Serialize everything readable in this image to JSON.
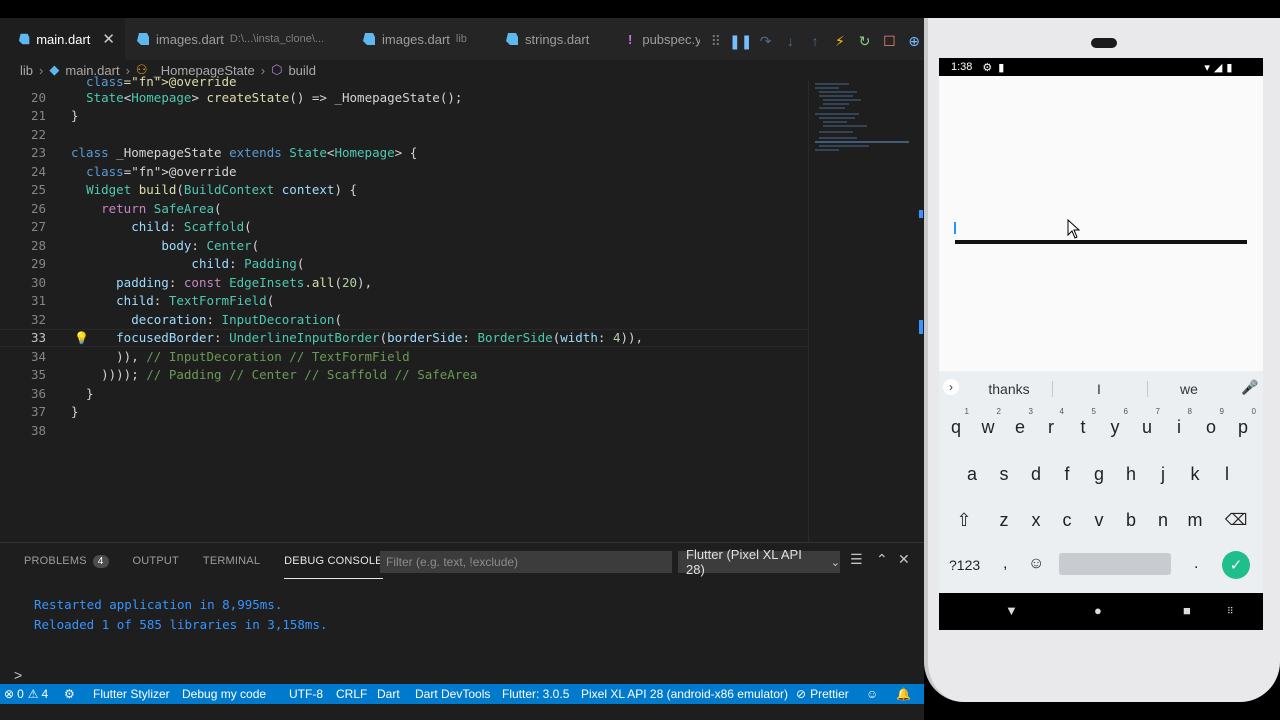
{
  "tabs": [
    {
      "label": "main.dart",
      "desc": "",
      "icon": "dart-icon",
      "active": true
    },
    {
      "label": "images.dart",
      "desc": "D:\\...\\insta_clone\\...",
      "icon": "dart-icon",
      "active": false
    },
    {
      "label": "images.dart",
      "desc": "lib",
      "icon": "dart-icon",
      "active": false
    },
    {
      "label": "strings.dart",
      "desc": "",
      "icon": "dart-icon",
      "active": false
    },
    {
      "label": "pubspec.y",
      "desc": "",
      "icon": "exclamation-icon",
      "active": false
    }
  ],
  "breadcrumb": [
    "lib",
    "main.dart",
    "_HomepageState",
    "build"
  ],
  "editor": {
    "partial_top_line": "@override",
    "lines": [
      {
        "n": "20",
        "text": "  State<Homepage> createState() => _HomepageState();"
      },
      {
        "n": "21",
        "text": "}"
      },
      {
        "n": "22",
        "text": ""
      },
      {
        "n": "23",
        "text": "class _HomepageState extends State<Homepage> {"
      },
      {
        "n": "24",
        "text": "  @override"
      },
      {
        "n": "25",
        "text": "  Widget build(BuildContext context) {"
      },
      {
        "n": "26",
        "text": "    return SafeArea("
      },
      {
        "n": "27",
        "text": "        child: Scaffold("
      },
      {
        "n": "28",
        "text": "            body: Center("
      },
      {
        "n": "29",
        "text": "                child: Padding("
      },
      {
        "n": "30",
        "text": "      padding: const EdgeInsets.all(20),"
      },
      {
        "n": "31",
        "text": "      child: TextFormField("
      },
      {
        "n": "32",
        "text": "        decoration: InputDecoration("
      },
      {
        "n": "33",
        "text": "      focusedBorder: UnderlineInputBorder(borderSide: BorderSide(width: 4)),"
      },
      {
        "n": "34",
        "text": "      )), // InputDecoration // TextFormField"
      },
      {
        "n": "35",
        "text": "    )))); // Padding // Center // Scaffold // SafeArea"
      },
      {
        "n": "36",
        "text": "  }"
      },
      {
        "n": "37",
        "text": "}"
      },
      {
        "n": "38",
        "text": ""
      }
    ]
  },
  "panel": {
    "tabs": [
      "PROBLEMS",
      "OUTPUT",
      "TERMINAL",
      "DEBUG CONSOLE"
    ],
    "problems_count": "4",
    "filter_placeholder": "Filter (e.g. text, !exclude)",
    "device_select": "Flutter (Pixel XL API 28)",
    "console": [
      "Restarted application in 8,995ms.",
      "Reloaded 1 of 585 libraries in 3,158ms."
    ],
    "prompt": ">"
  },
  "statusbar": {
    "errors": "0",
    "warnings": "4",
    "items": [
      "Flutter Stylizer",
      "Debug my code",
      "UTF-8",
      "CRLF",
      "Dart",
      "Dart DevTools",
      "Flutter: 3.0.5",
      "Pixel XL API 28 (android-x86 emulator)",
      "Prettier"
    ]
  },
  "phone": {
    "time": "1:38",
    "suggestions": [
      "thanks",
      "I",
      "we"
    ],
    "row1": [
      "q",
      "w",
      "e",
      "r",
      "t",
      "y",
      "u",
      "i",
      "o",
      "p"
    ],
    "row1_hints": [
      "1",
      "2",
      "3",
      "4",
      "5",
      "6",
      "7",
      "8",
      "9",
      "0"
    ],
    "row2": [
      "a",
      "s",
      "d",
      "f",
      "g",
      "h",
      "j",
      "k",
      "l"
    ],
    "row3": [
      "z",
      "x",
      "c",
      "v",
      "b",
      "n",
      "m"
    ],
    "symbols_key": "?123",
    "comma_key": ",",
    "period_key": "."
  },
  "colors": {
    "accent": "#007acc",
    "enter_key": "#1fbf8c",
    "console_text": "#3794ff"
  }
}
